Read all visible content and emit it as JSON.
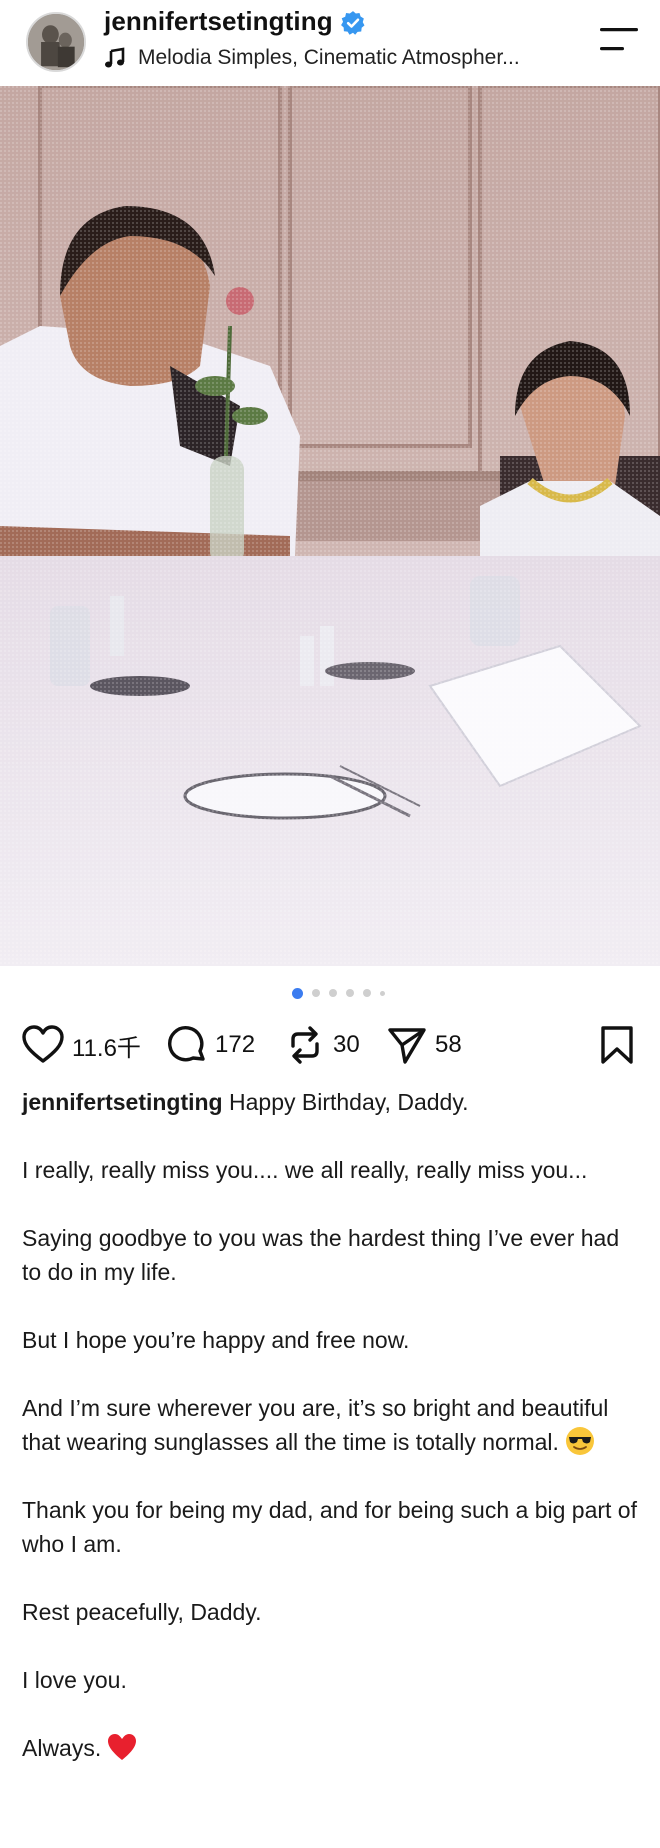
{
  "header": {
    "username": "jennifertsetingting",
    "music_title": "Melodia Simples, Cinematic Atmospher...",
    "avatar_icon": "profile-avatar",
    "verified_icon": "verified-badge-icon",
    "menu_icon": "menu-icon"
  },
  "carousel": {
    "total": 6,
    "active_index": 0
  },
  "actions": {
    "likes": "11.6千",
    "comments": "172",
    "reposts": "30",
    "shares": "58"
  },
  "caption": {
    "username": "jennifertsetingting",
    "first_line": "Happy Birthday, Daddy.",
    "p1": "I really, really miss you.... we all really, really miss you...",
    "p2": "Saying goodbye to you was the hardest thing I’ve ever had to do in my life.",
    "p3": "But I hope you’re happy and free now.",
    "p4": "And I’m sure wherever you are, it’s so bright and beautiful that wearing sunglasses all the time is totally normal.",
    "p5": "Thank you for being my dad, and for being such a big part of who I am.",
    "p6": "Rest peacefully, Daddy.",
    "p7": "I love you.",
    "p8": "Always."
  },
  "colors": {
    "verified_blue": "#3797f0",
    "active_dot": "#3b7cf0",
    "heart_red": "#e8202e"
  }
}
